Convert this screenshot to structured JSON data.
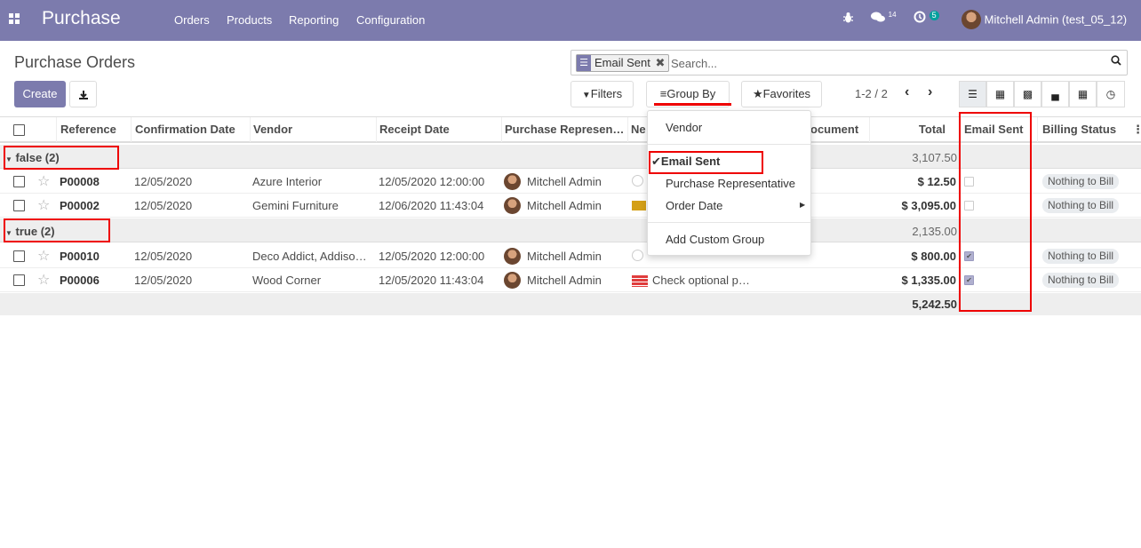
{
  "navbar": {
    "app_name": "Purchase",
    "menu": [
      "Orders",
      "Products",
      "Reporting",
      "Configuration"
    ],
    "messages_count": "14",
    "activities_count": "5",
    "user": "Mitchell Admin (test_05_12)"
  },
  "control_panel": {
    "title": "Purchase Orders",
    "create_label": "Create",
    "search": {
      "facet": "Email Sent",
      "placeholder": "Search..."
    },
    "filters_label": "Filters",
    "group_by_label": "Group By",
    "favorites_label": "Favorites",
    "pager": "1-2 / 2"
  },
  "group_by_menu": {
    "items": [
      "Vendor",
      "Email Sent",
      "Purchase Representative",
      "Order Date",
      "Add Custom Group"
    ],
    "checked_item": "Email Sent"
  },
  "table": {
    "columns": [
      "Reference",
      "Confirmation Date",
      "Vendor",
      "Receipt Date",
      "Purchase Represen…",
      "Ne",
      "ocument",
      "Total",
      "Email Sent",
      "Billing Status"
    ],
    "groups": [
      {
        "label": "false (2)",
        "total": "3,107.50",
        "rows": [
          {
            "reference": "P00008",
            "confirmation_date": "12/05/2020",
            "vendor": "Azure Interior",
            "receipt_date": "12/05/2020 12:00:00",
            "rep": "Mitchell Admin",
            "activity": "",
            "total": "$ 12.50",
            "email_sent": false,
            "billing": "Nothing to Bill"
          },
          {
            "reference": "P00002",
            "confirmation_date": "12/05/2020",
            "vendor": "Gemini Furniture",
            "receipt_date": "12/06/2020 11:43:04",
            "rep": "Mitchell Admin",
            "activity": "",
            "total": "$ 3,095.00",
            "email_sent": false,
            "billing": "Nothing to Bill"
          }
        ]
      },
      {
        "label": "true (2)",
        "total": "2,135.00",
        "rows": [
          {
            "reference": "P00010",
            "confirmation_date": "12/05/2020",
            "vendor": "Deco Addict, Addiso…",
            "receipt_date": "12/05/2020 12:00:00",
            "rep": "Mitchell Admin",
            "activity": "",
            "total": "$ 800.00",
            "email_sent": true,
            "billing": "Nothing to Bill"
          },
          {
            "reference": "P00006",
            "confirmation_date": "12/05/2020",
            "vendor": "Wood Corner",
            "receipt_date": "12/05/2020 11:43:04",
            "rep": "Mitchell Admin",
            "activity": "Check optional p…",
            "total": "$ 1,335.00",
            "email_sent": true,
            "billing": "Nothing to Bill"
          }
        ]
      }
    ],
    "grand_total": "5,242.50"
  }
}
